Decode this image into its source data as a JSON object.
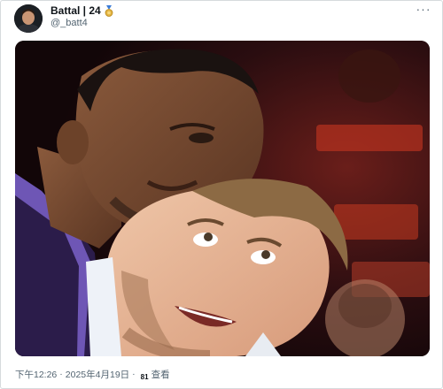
{
  "tweet": {
    "author": {
      "display_name": "Battal | 24",
      "handle": "@_batt4",
      "badge_icon": "medal-icon"
    },
    "more_icon": "more-horizontal-icon",
    "more_label": "···",
    "time": "下午12:26",
    "separator": "·",
    "date": "2025年4月19日",
    "views_count": "81",
    "views_label": "查看"
  },
  "colors": {
    "text_primary": "#0f1419",
    "text_secondary": "#536471",
    "border": "#d6dadd"
  }
}
